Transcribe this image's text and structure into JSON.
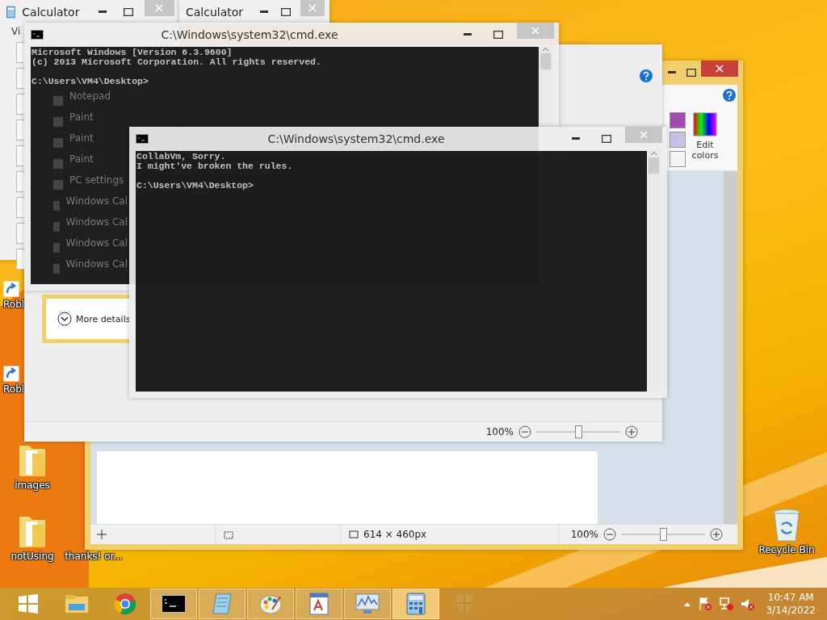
{
  "desktop_icons": [
    {
      "kind": "shortcut",
      "label": "Robl"
    },
    {
      "kind": "shortcut",
      "label": "Robl"
    },
    {
      "kind": "folder",
      "label": "images"
    },
    {
      "kind": "folder",
      "label": "notUsing"
    },
    {
      "kind": "file",
      "label": "thanks! or..."
    },
    {
      "kind": "recycle",
      "label": "Recycle Bin"
    }
  ],
  "paint": {
    "palette": [
      {
        "color": "#a24ab0"
      },
      {
        "color": "#c8bfe7"
      },
      {
        "color": "#f4f4f4"
      }
    ],
    "edit_colors": "Edit colors",
    "size": "614 × 460px",
    "zoom": "100%",
    "zoom_slider": {
      "level": 0.5
    }
  },
  "viewer": {
    "zoom": "100%",
    "zoom_slider": {
      "level": 0.5
    }
  },
  "calculators": [
    {
      "title": "Calculator",
      "menu": "Vi"
    },
    {
      "title": "Calculator"
    }
  ],
  "task_manager": {
    "items": [
      "Notepad",
      "Paint",
      "Paint",
      "Paint",
      "PC settings",
      "Windows Cal",
      "Windows Cal",
      "Windows Cal",
      "Windows Cal"
    ],
    "more_details": "More details"
  },
  "cmd_windows": [
    {
      "title": "C:\\Windows\\system32\\cmd.exe",
      "output": [
        "Microsoft Windows [Version 6.3.9600]",
        "(c) 2013 Microsoft Corporation. All rights reserved."
      ],
      "prompt": "C:\\Users\\VM4\\Desktop>"
    },
    {
      "title": "C:\\Windows\\system32\\cmd.exe",
      "output": [
        "CollabVm, Sorry.",
        "I might've broken the rules."
      ],
      "prompt": "C:\\Users\\VM4\\Desktop>"
    }
  ],
  "taskbar": {
    "apps": [
      {
        "kind": "start",
        "open": false,
        "focused": false
      },
      {
        "kind": "explorer",
        "open": false,
        "focused": false
      },
      {
        "kind": "browser",
        "open": false,
        "focused": false
      },
      {
        "kind": "terminal",
        "open": true,
        "focused": false
      },
      {
        "kind": "notepad",
        "open": true,
        "focused": false
      },
      {
        "kind": "paint",
        "open": true,
        "focused": false
      },
      {
        "kind": "wordpad",
        "open": true,
        "focused": false
      },
      {
        "kind": "monitor",
        "open": true,
        "focused": false
      },
      {
        "kind": "calculator",
        "open": true,
        "focused": true
      },
      {
        "kind": "shield",
        "open": false,
        "focused": false
      }
    ],
    "time": "10:47 AM",
    "date": "3/14/2022"
  }
}
